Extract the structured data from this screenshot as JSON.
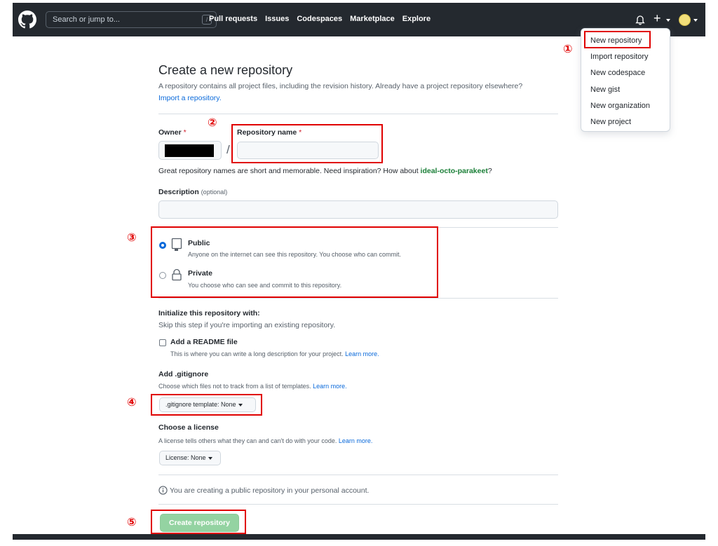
{
  "header": {
    "search_placeholder": "Search or jump to...",
    "search_shortcut": "/",
    "nav": [
      "Pull requests",
      "Issues",
      "Codespaces",
      "Marketplace",
      "Explore"
    ]
  },
  "dropdown": {
    "items": [
      "New repository",
      "Import repository",
      "New codespace",
      "New gist",
      "New organization",
      "New project"
    ]
  },
  "page": {
    "title": "Create a new repository",
    "subtitle": "A repository contains all project files, including the revision history. Already have a project repository elsewhere?",
    "import_link": "Import a repository.",
    "owner_label": "Owner",
    "required_mark": "*",
    "separator": "/",
    "repo_name_label": "Repository name",
    "name_hint": "Great repository names are short and memorable. Need inspiration? How about",
    "name_suggestion": "ideal-octo-parakeet",
    "name_hint_end": "?",
    "description_label": "Description",
    "description_optional": "(optional)",
    "public_label": "Public",
    "public_desc": "Anyone on the internet can see this repository. You choose who can commit.",
    "private_label": "Private",
    "private_desc": "You choose who can see and commit to this repository.",
    "init_title": "Initialize this repository with:",
    "init_sub": "Skip this step if you're importing an existing repository.",
    "readme_label": "Add a README file",
    "readme_desc": "This is where you can write a long description for your project.",
    "learn_more": "Learn more.",
    "gitignore_title": "Add .gitignore",
    "gitignore_desc": "Choose which files not to track from a list of templates.",
    "gitignore_button": ".gitignore template: None",
    "license_title": "Choose a license",
    "license_desc": "A license tells others what they can and can't do with your code.",
    "license_button": "License: None",
    "notice": "You are creating a public repository in your personal account.",
    "create_button": "Create repository"
  },
  "annotations": [
    "①",
    "②",
    "③",
    "④",
    "⑤"
  ],
  "colors": {
    "header_bg": "#24292f",
    "annotation_red": "#e00000",
    "link_blue": "#0969da",
    "create_green": "#94d3a2",
    "suggestion_green": "#1a7f37"
  }
}
